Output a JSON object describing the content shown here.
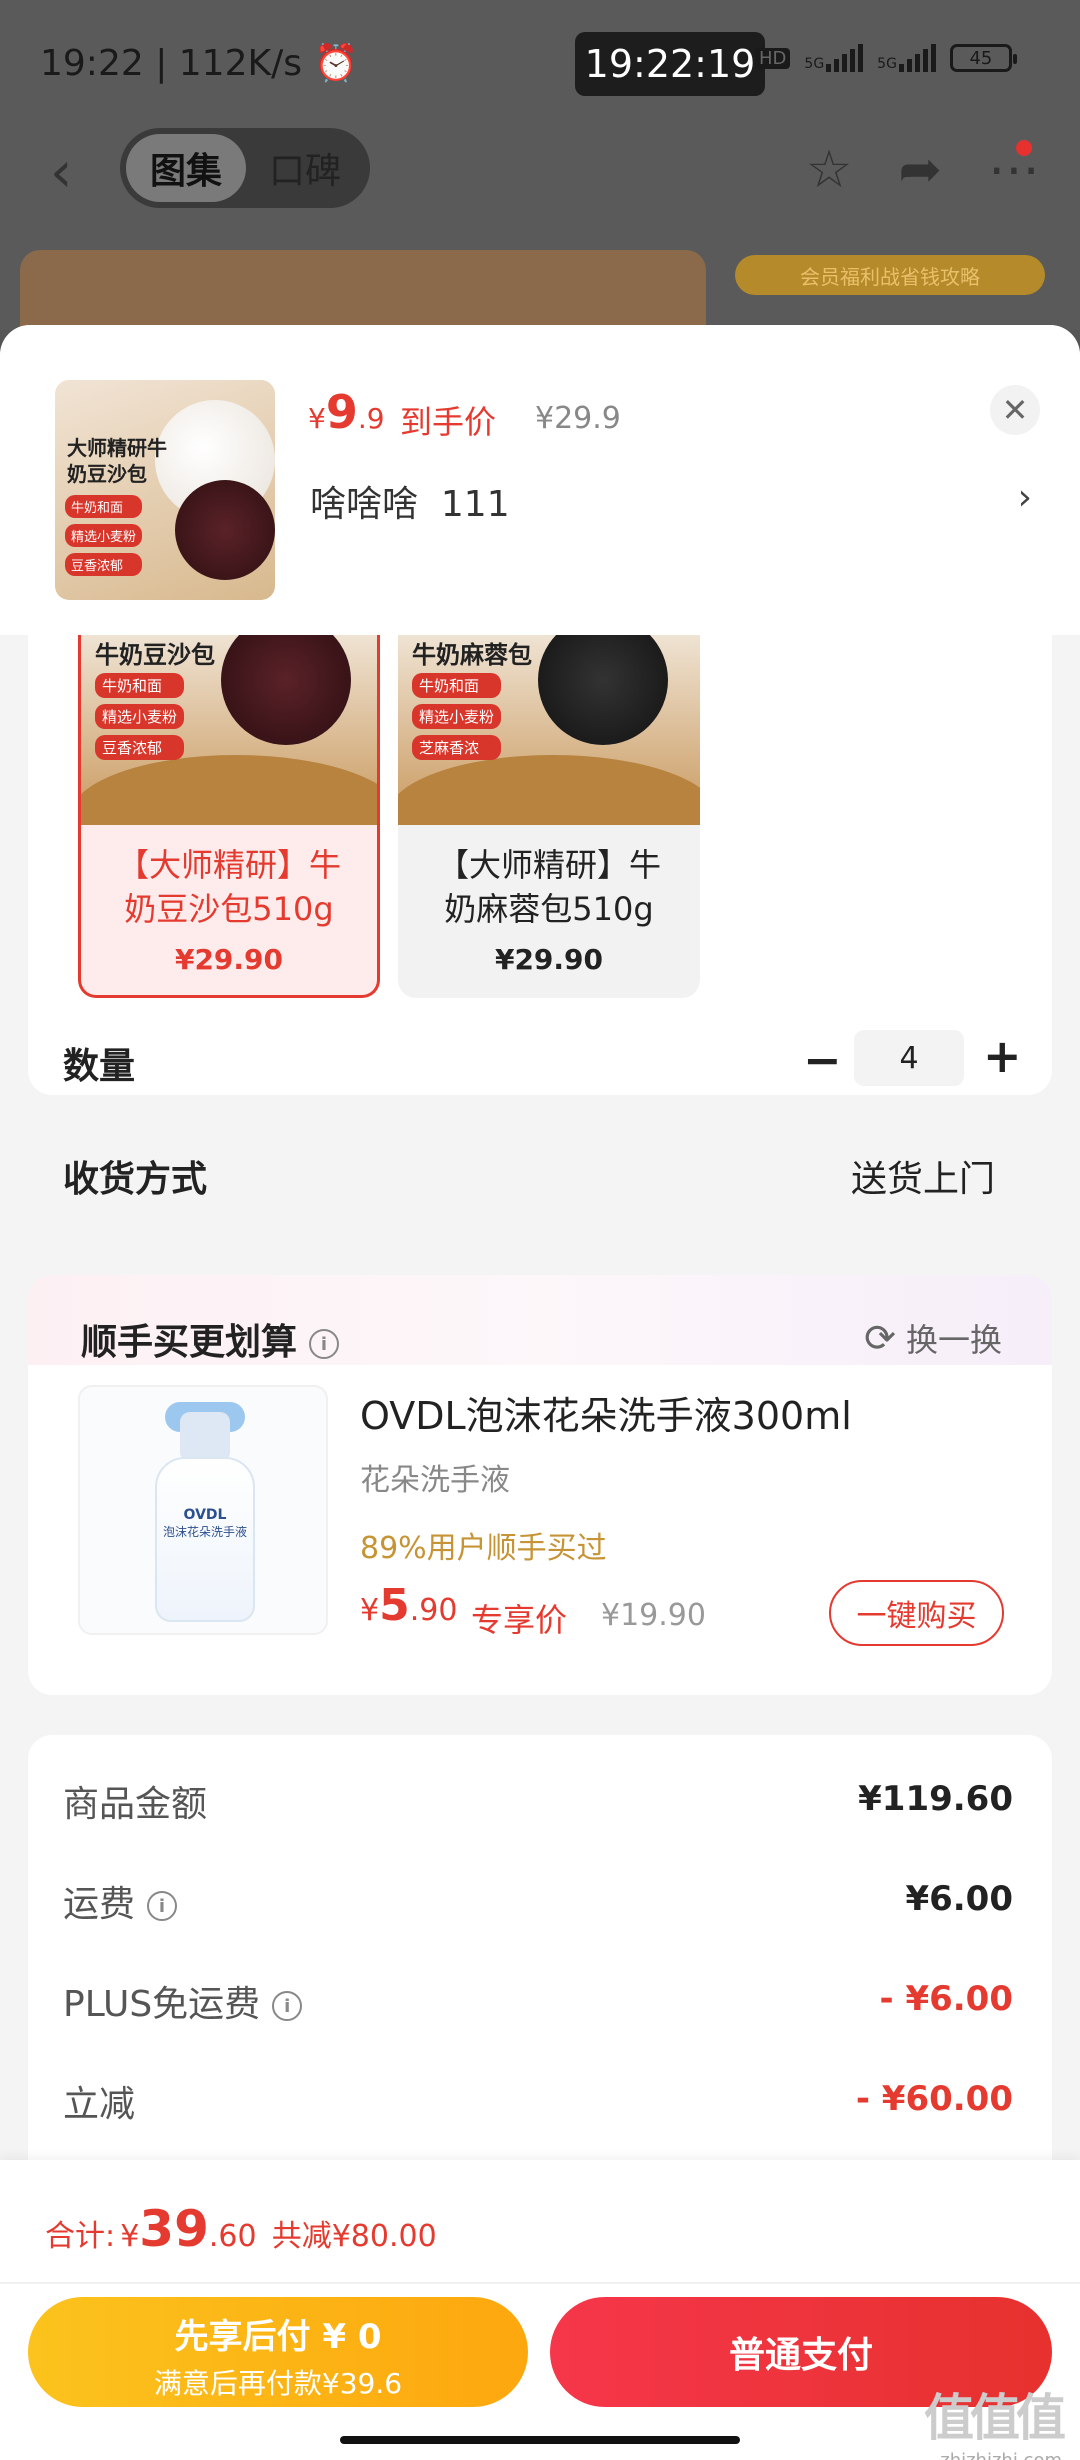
{
  "status_bar": {
    "time": "19:22",
    "speed": "112K/s",
    "clock_overlay": "19:22:19",
    "hd": "HD",
    "net1": "5G",
    "net2": "5G",
    "battery": "45"
  },
  "nav": {
    "tab_active": "图集",
    "tab_inactive": "口碑"
  },
  "bg": {
    "coupon_text": "会员福利战省钱攻略"
  },
  "product": {
    "thumb_title": "大师精研牛奶豆沙包",
    "thumb_tags": [
      "牛奶和面",
      "精选小麦粉",
      "豆香浓郁"
    ],
    "price_symbol": "¥",
    "price_int": "9",
    "price_dec": ".9",
    "price_tag": "到手价",
    "price_orig": "¥29.9",
    "selected_spec": "啥啥啥  111"
  },
  "variants": [
    {
      "img_label": "牛奶豆沙包",
      "tags": [
        "牛奶和面",
        "精选小麦粉",
        "豆香浓郁"
      ],
      "name": "【大师精研】牛奶豆沙包510g",
      "price": "¥29.90"
    },
    {
      "img_label": "牛奶麻蓉包",
      "tags": [
        "牛奶和面",
        "精选小麦粉",
        "芝麻香浓"
      ],
      "name": "【大师精研】牛奶麻蓉包510g",
      "price": "¥29.90"
    }
  ],
  "quantity": {
    "label": "数量",
    "value": "4",
    "minus": "−",
    "plus": "+"
  },
  "delivery": {
    "label": "收货方式",
    "value": "送货上门"
  },
  "upsell": {
    "title": "顺手买更划算",
    "refresh": "换一换",
    "name": "OVDL泡沫花朵洗手液300ml",
    "sub": "花朵洗手液",
    "percent": "89%用户顺手买过",
    "price_symbol": "¥",
    "price_int": "5",
    "price_dec": ".90",
    "price_tag": "专享价",
    "price_orig": "¥19.90",
    "buy_label": "一键购买",
    "bottle_brand": "OVDL",
    "bottle_text": "泡沫花朵洗手液"
  },
  "fees": [
    {
      "label": "商品金额",
      "value": "¥119.60",
      "info": false,
      "red": false
    },
    {
      "label": "运费",
      "value": "¥6.00",
      "info": true,
      "red": false
    },
    {
      "label": "PLUS免运费",
      "value": "- ¥6.00",
      "info": true,
      "red": true
    },
    {
      "label": "立减",
      "value": "- ¥60.00",
      "info": false,
      "red": true
    }
  ],
  "bottom": {
    "total_label": "合计:",
    "total_symbol": "¥",
    "total_int": "39",
    "total_dec": ".60",
    "saved": "共减¥80.00",
    "later_line1": "先享后付 ¥ 0",
    "later_line2": "满意后再付款¥39.6",
    "pay_label": "普通支付"
  },
  "watermark": {
    "logo": "值值值",
    "url": "zhizhizhi.com"
  },
  "colors": {
    "accent": "#e43a2f",
    "gold": "#c79435",
    "later_btn": "#fdb514",
    "pay_btn": "#ee3440"
  }
}
